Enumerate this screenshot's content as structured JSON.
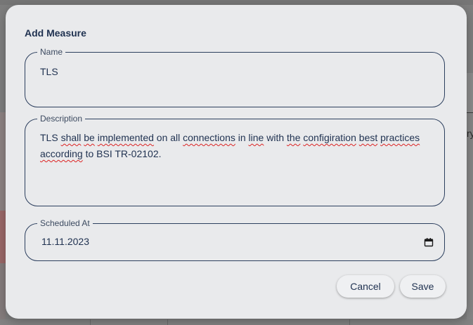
{
  "dialog": {
    "title": "Add Measure",
    "name_field": {
      "label": "Name",
      "value": "TLS"
    },
    "description_field": {
      "label": "Description",
      "value_parts": [
        {
          "text": "TLS ",
          "misspelled": false
        },
        {
          "text": "shall",
          "misspelled": true
        },
        {
          "text": " ",
          "misspelled": false
        },
        {
          "text": "be",
          "misspelled": true
        },
        {
          "text": " ",
          "misspelled": false
        },
        {
          "text": "implemented",
          "misspelled": true
        },
        {
          "text": " on all ",
          "misspelled": false
        },
        {
          "text": "connections",
          "misspelled": true
        },
        {
          "text": " in ",
          "misspelled": false
        },
        {
          "text": "line",
          "misspelled": true
        },
        {
          "text": " with ",
          "misspelled": false
        },
        {
          "text": "the",
          "misspelled": true
        },
        {
          "text": " ",
          "misspelled": false
        },
        {
          "text": "configiration",
          "misspelled": true
        },
        {
          "text": " ",
          "misspelled": false
        },
        {
          "text": "best",
          "misspelled": true
        },
        {
          "text": " ",
          "misspelled": false
        },
        {
          "text": "practices",
          "misspelled": true
        },
        {
          "text": " ",
          "misspelled": false
        },
        {
          "text": "according",
          "misspelled": true
        },
        {
          "text": " to BSI TR-02102.",
          "misspelled": false
        }
      ]
    },
    "scheduled_field": {
      "label": "Scheduled At",
      "value": "11.11.2023",
      "icon": "calendar-icon"
    },
    "buttons": {
      "cancel_label": "Cancel",
      "save_label": "Save"
    }
  },
  "background": {
    "peek_glyph": "ry"
  },
  "colors": {
    "dialog_bg": "#e9eaec",
    "text": "#1f3150",
    "border": "#2c3f5e",
    "spellcheck": "#dd2222",
    "backdrop": "#7e7e7e"
  }
}
